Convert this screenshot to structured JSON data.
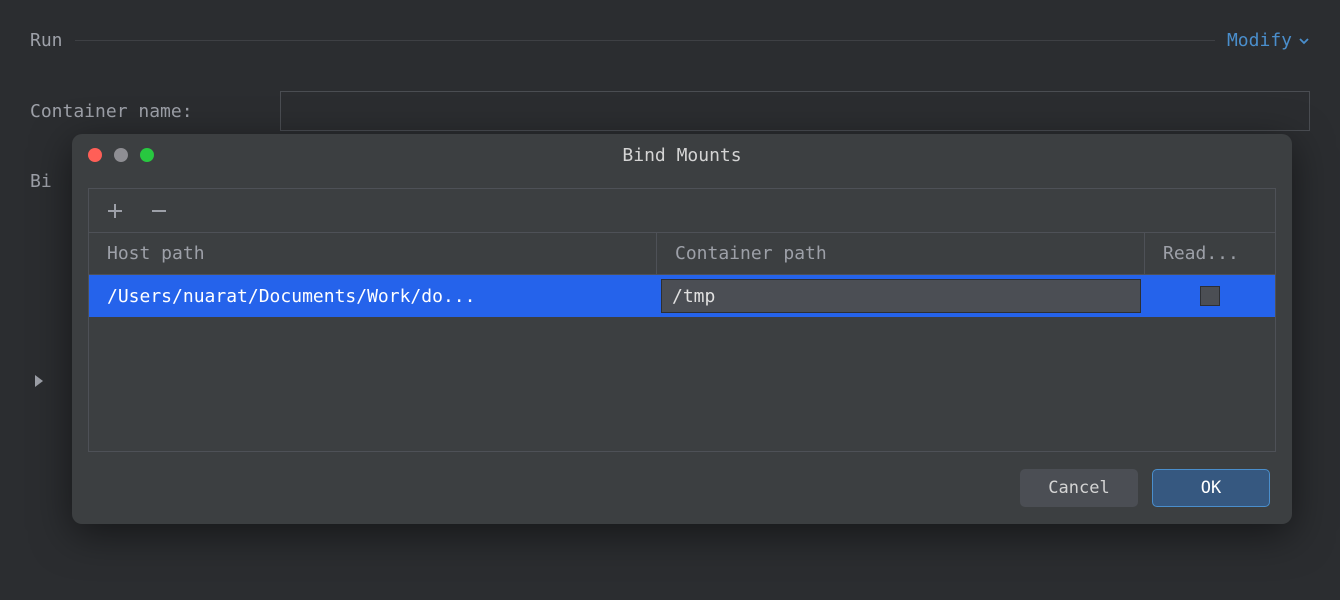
{
  "run": {
    "label": "Run",
    "modify": "Modify"
  },
  "fields": {
    "container_name_label": "Container name:",
    "bi_label": "Bi"
  },
  "dialog": {
    "title": "Bind Mounts",
    "columns": {
      "host": "Host path",
      "container": "Container path",
      "read": "Read..."
    },
    "rows": [
      {
        "host_path": "/Users/nuarat/Documents/Work/do...",
        "container_path": "/tmp",
        "read_only": false
      }
    ],
    "buttons": {
      "cancel": "Cancel",
      "ok": "OK"
    }
  }
}
